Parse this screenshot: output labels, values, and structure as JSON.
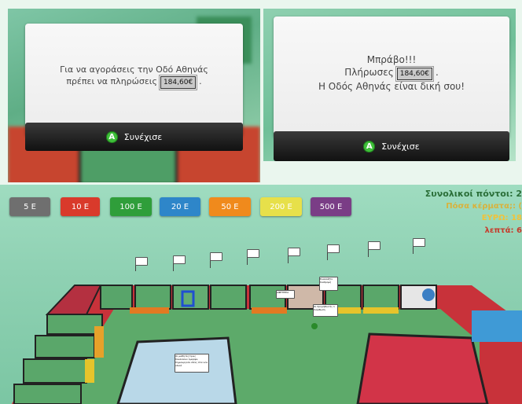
{
  "dialog_buy": {
    "line1": "Για να αγοράσεις την Οδό Αθηνάς",
    "line2_prefix": "πρέπει να πληρώσεις",
    "price": "184,60€",
    "line2_suffix": ".",
    "button_key": "A",
    "button_label": "Συνέχισε"
  },
  "dialog_bought": {
    "line1": "Μπράβο!!!",
    "line2_prefix": "Πλήρωσες",
    "price": "184,60€",
    "line2_suffix": ".",
    "line3": "Η Οδός Αθηνάς είναι δική σου!",
    "button_key": "A",
    "button_label": "Συνέχισε"
  },
  "coins": [
    {
      "label": "5 Ε",
      "color": "#6f6f6f"
    },
    {
      "label": "10 Ε",
      "color": "#d93a2b"
    },
    {
      "label": "100 Ε",
      "color": "#2f9e3a"
    },
    {
      "label": "20 Ε",
      "color": "#2e86c9"
    },
    {
      "label": "50 Ε",
      "color": "#f08a1c"
    },
    {
      "label": "200 Ε",
      "color": "#e7e04a"
    },
    {
      "label": "500 Ε",
      "color": "#7a3d86"
    }
  ],
  "scores": {
    "total": "Συνολικοί πόντοι: 2",
    "coins_q": "Πόσα κέρματα;: (",
    "euro": "ΕΥΡΩ: 18",
    "cents": "λεπτά: 6"
  },
  "board_labels": {
    "bubble_a": "Εναλλάξτε διαδρομή",
    "bubble_b": "ΑΦΕΤΗΡΙΑ",
    "bubble_c": "Οι προμηθευτές 1 διόρθωση",
    "card_text": "Οι μαθητές/τριες δουλεύουν όμορφα, δημιουργούν ιδέες στα νέα υλικά"
  }
}
